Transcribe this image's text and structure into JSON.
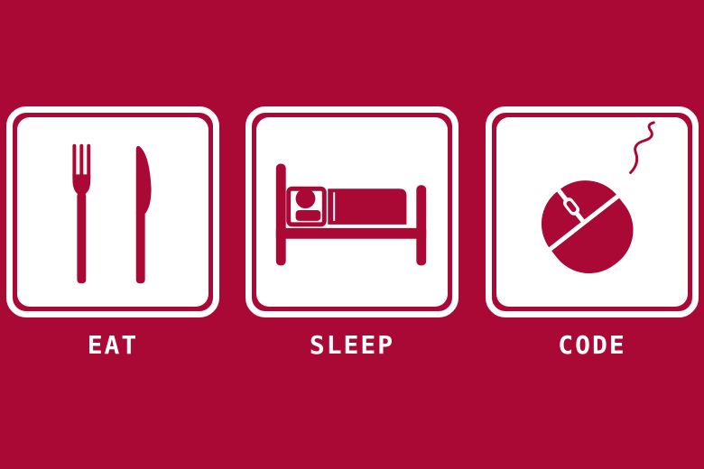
{
  "colors": {
    "background": "#aa0835",
    "tile": "#ffffff",
    "glyph": "#aa0835"
  },
  "panels": [
    {
      "caption": "EAT",
      "icon": "fork-and-knife-icon"
    },
    {
      "caption": "SLEEP",
      "icon": "person-in-bed-icon"
    },
    {
      "caption": "CODE",
      "icon": "computer-mouse-icon"
    }
  ]
}
